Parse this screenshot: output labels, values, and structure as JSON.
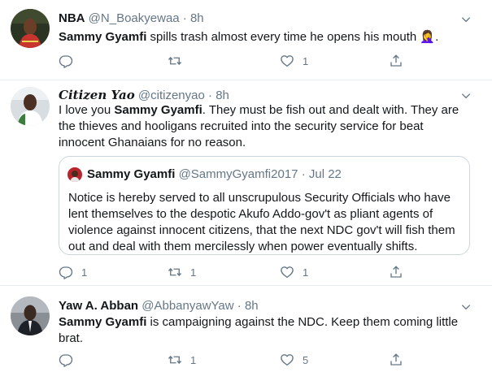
{
  "tweets": [
    {
      "name": "NBA",
      "handle": "@N_Boakyewaa",
      "separator": "·",
      "time": "8h",
      "text_bold": "Sammy Gyamfi",
      "text_rest": " spills trash almost every time he opens his mouth ",
      "text_emoji": "🤦‍♀️",
      "text_tail": ".",
      "reply_count": "",
      "retweet_count": "",
      "like_count": "1"
    },
    {
      "name": "Citizen Yao",
      "handle": "@citizenyao",
      "separator": "·",
      "time": "8h",
      "text_pre": "I love you ",
      "text_bold": "Sammy Gyamfi",
      "text_rest": ". They must be fish out and dealt with. They are the thieves and hooligans recruited into the security service for beat innocent Ghanaians for no reason.",
      "quote": {
        "name": "Sammy Gyamfi",
        "handle": "@SammyGyamfi2017",
        "separator": "·",
        "date": "Jul 22",
        "text": "Notice is hereby served to all unscrupulous Security Officials who have lent themselves to the despotic Akufo Addo-gov't as pliant agents of violence against innocent citizens, that the next NDC gov't will fish them out and deal with them mercilessly when power eventually shifts."
      },
      "reply_count": "1",
      "retweet_count": "1",
      "like_count": "1"
    },
    {
      "name": "Yaw A. Abban",
      "handle": "@AbbanyawYaw",
      "separator": "·",
      "time": "8h",
      "text_bold": "Sammy Gyamfi",
      "text_rest": " is campaigning against the NDC. Keep them coming little brat.",
      "reply_count": "",
      "retweet_count": "1",
      "like_count": "5"
    }
  ],
  "icons": {
    "reply": "reply-icon",
    "retweet": "retweet-icon",
    "like": "heart-icon",
    "share": "share-icon",
    "more": "chevron-down-icon"
  },
  "colors": {
    "secondary_text": "#657786",
    "divider": "#e6ecf0",
    "quote_border": "#ccd6dd"
  }
}
